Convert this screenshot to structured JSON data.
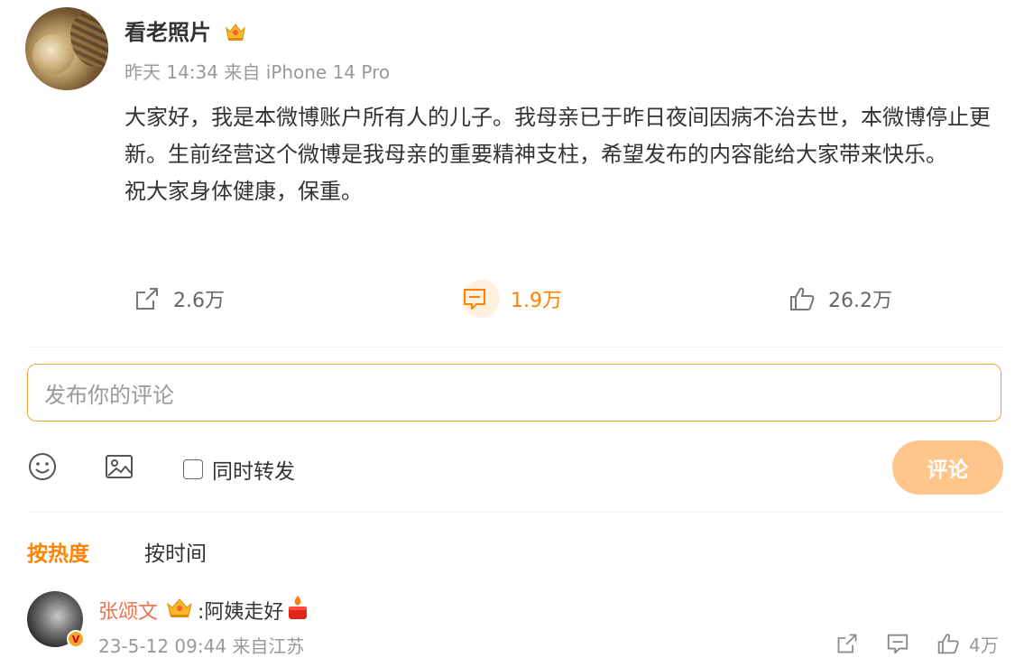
{
  "post": {
    "username": "看老照片",
    "meta": "昨天 14:34 来自 iPhone 14 Pro",
    "paragraphs": [
      "大家好，我是本微博账户所有人的儿子。我母亲已于昨日夜间因病不治去世，本微博停止更新。生前经营这个微博是我母亲的重要精神支柱，希望发布的内容能给大家带来快乐。",
      "祝大家身体健康，保重。"
    ],
    "repost_count": "2.6万",
    "comment_count": "1.9万",
    "like_count": "26.2万"
  },
  "composer": {
    "placeholder": "发布你的评论",
    "repost_label": "同时转发",
    "submit_label": "评论"
  },
  "sort": {
    "hot_label": "按热度",
    "time_label": "按时间"
  },
  "comments": [
    {
      "name": "张颂文",
      "text": ":阿姨走好",
      "meta": "23-5-12 09:44 来自江苏",
      "like_count": "4万"
    }
  ],
  "colors": {
    "accent": "#ff8200",
    "submit_bg": "#ffc58a",
    "comment_name": "#eb7350",
    "input_border": "#f0a53a"
  },
  "icons": [
    "vip-crown-icon",
    "repost-icon",
    "comment-icon",
    "like-icon",
    "emoji-icon",
    "image-icon",
    "candle-icon",
    "verified-badge-icon"
  ]
}
